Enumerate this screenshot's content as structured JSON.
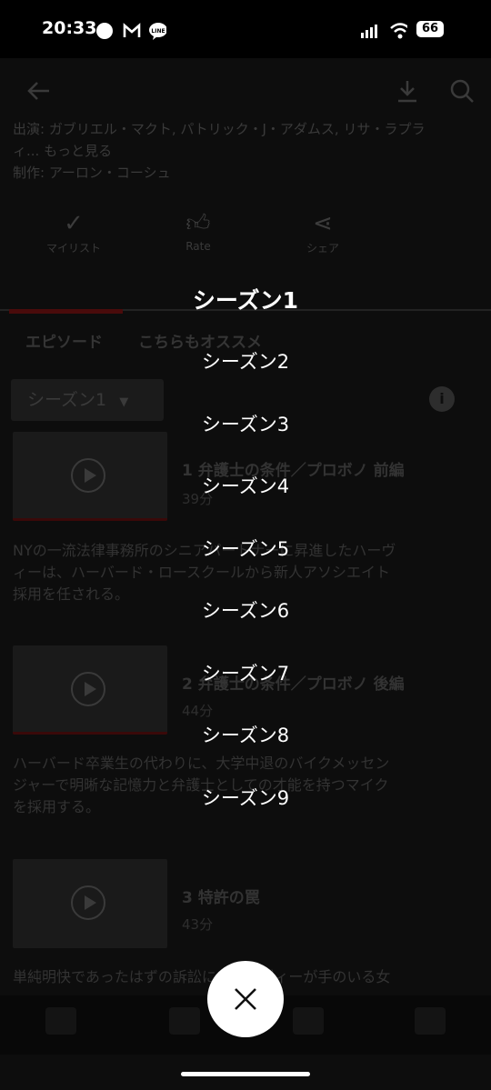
{
  "status_bar": {
    "time": "20:33",
    "battery": "66",
    "icons": [
      "circle-icon",
      "gmail-icon",
      "line-icon",
      "signal-icon",
      "wifi-icon",
      "battery-icon"
    ]
  },
  "background": {
    "cast_line1": "出演: ガブリエル・マクト, パトリック・J・アダムス, リサ・ラプラ",
    "cast_line2": "ィ... もっと見る",
    "creator": "制作: アーロン・コーシュ",
    "actions": [
      {
        "label": "マイリスト",
        "icon": "checkmark-icon"
      },
      {
        "label": "Rate",
        "icon": "thumbs-up-icon"
      },
      {
        "label": "シェア",
        "icon": "share-icon"
      }
    ],
    "tabs": [
      "エピソード",
      "こちらもオススメ"
    ],
    "season_dropdown": "シーズン1",
    "episodes": [
      {
        "title": "1 弁護士の条件／プロボノ 前編",
        "duration": "39分",
        "desc": [
          "NYの一流法律事務所のシニアパートナーに昇進したハーヴ",
          "ィーは、ハーバード・ロースクールから新人アソシエイト",
          "採用を任される。"
        ]
      },
      {
        "title": "2 弁護士の条件／プロボノ 後編",
        "duration": "44分",
        "desc": [
          "ハーバード卒業生の代わりに、大学中退のバイクメッセン",
          "ジャーで明晰な記憶力と弁護士としての才能を持つマイク",
          "を採用する。"
        ]
      },
      {
        "title": "3 特許の罠",
        "duration": "43分",
        "desc": [
          "単純明快であったはずの訴訟に、ハーヴィーが手のいる女"
        ]
      }
    ]
  },
  "season_picker": {
    "items": [
      "シーズン1",
      "シーズン2",
      "シーズン3",
      "シーズン4",
      "シーズン5",
      "シーズン6",
      "シーズン7",
      "シーズン8",
      "シーズン9"
    ],
    "selected_index": 0
  }
}
